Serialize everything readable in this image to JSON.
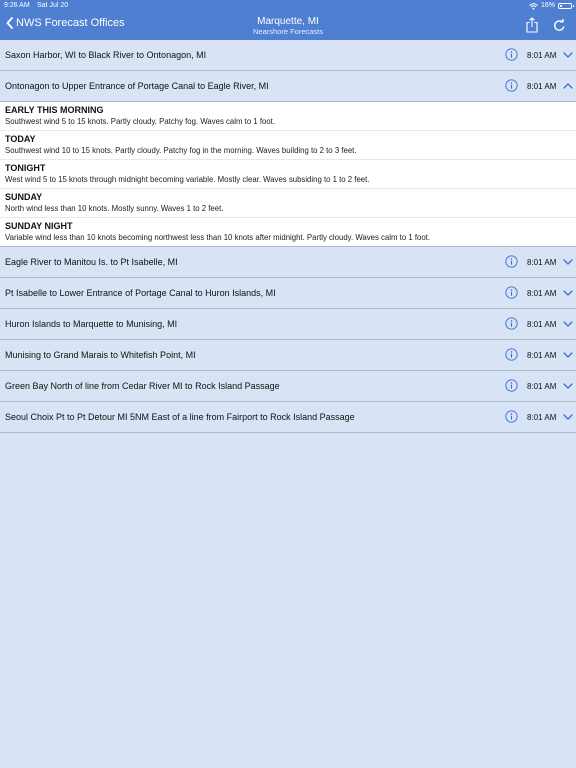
{
  "status_bar": {
    "time": "9:26 AM",
    "date": "Sat Jul 20",
    "battery": "16%",
    "battery_level": 0.16
  },
  "navbar": {
    "back_label": "NWS Forecast Offices",
    "title": "Marquette, MI",
    "subtitle": "Nearshore Forecasts"
  },
  "zones": [
    {
      "name": "Saxon Harbor, WI to Black River to Ontonagon, MI",
      "time": "8:01 AM",
      "expanded": false
    },
    {
      "name": "Ontonagon to Upper Entrance of Portage Canal to Eagle River, MI",
      "time": "8:01 AM",
      "expanded": true
    },
    {
      "name": "Eagle River to Manitou Is. to Pt Isabelle, MI",
      "time": "8:01 AM",
      "expanded": false
    },
    {
      "name": "Pt Isabelle to Lower Entrance of Portage Canal to Huron Islands, MI",
      "time": "8:01 AM",
      "expanded": false
    },
    {
      "name": "Huron Islands to Marquette to Munising, MI",
      "time": "8:01 AM",
      "expanded": false
    },
    {
      "name": "Munising to Grand Marais to Whitefish Point, MI",
      "time": "8:01 AM",
      "expanded": false
    },
    {
      "name": "Green Bay North of line from Cedar River MI to Rock Island Passage",
      "time": "8:01 AM",
      "expanded": false
    },
    {
      "name": "Seoul Choix Pt to Pt Detour MI 5NM East of a line from Fairport to Rock Island Passage",
      "time": "8:01 AM",
      "expanded": false
    }
  ],
  "forecast": [
    {
      "period": "EARLY THIS MORNING",
      "text": "Southwest wind 5 to 15 knots. Partly cloudy. Patchy fog. Waves calm to 1 foot."
    },
    {
      "period": "TODAY",
      "text": "Southwest wind 10 to 15 knots. Partly cloudy. Patchy fog in the morning. Waves building to 2 to 3 feet."
    },
    {
      "period": "TONIGHT",
      "text": "West wind 5 to 15 knots through midnight becoming variable. Mostly clear. Waves subsiding to 1 to 2 feet."
    },
    {
      "period": "SUNDAY",
      "text": "North wind less than 10 knots. Mostly sunny. Waves 1 to 2 feet."
    },
    {
      "period": "SUNDAY NIGHT",
      "text": "Variable wind less than 10 knots becoming northwest less than 10 knots after midnight. Partly cloudy. Waves calm to 1 foot."
    }
  ],
  "icons": {
    "info": "info-circle-icon",
    "chevron_down": "chevron-down-icon",
    "chevron_up": "chevron-up-icon",
    "share": "share-icon",
    "refresh": "refresh-icon",
    "back": "chevron-left-icon"
  },
  "colors": {
    "bar": "#4f7fd1",
    "background": "#d8e3f6",
    "accent": "#3b6fd0"
  }
}
